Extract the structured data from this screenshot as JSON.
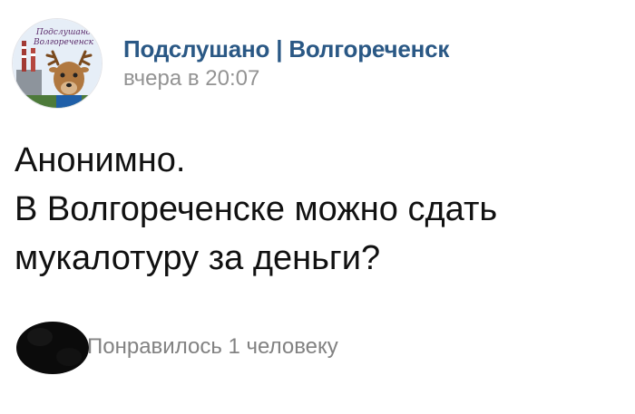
{
  "post": {
    "author": "Подслушано | Волгореченск",
    "time": "вчера в 20:07",
    "text_lines": [
      "Анонимно.",
      "В Волгореченске можно сдать",
      "мукалотуру за деньги?"
    ]
  },
  "avatar": {
    "logo_line1": "Подслушано",
    "logo_line2": "Волгореченск"
  },
  "likes": {
    "text": "Понравилось 1 человеку"
  },
  "colors": {
    "author_link": "#2a5885",
    "meta_text": "#939393",
    "likes_text": "#828282"
  }
}
